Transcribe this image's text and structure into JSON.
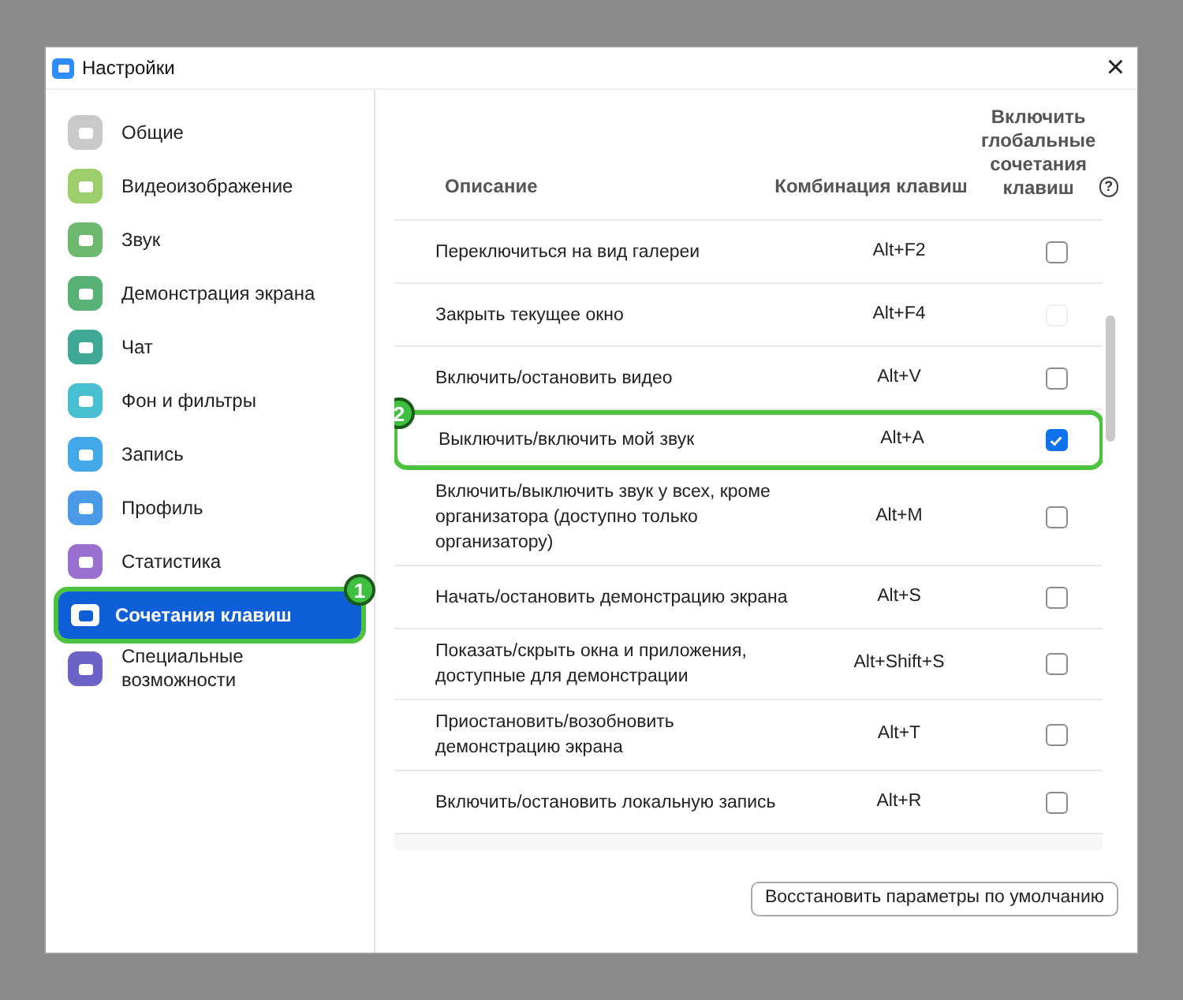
{
  "window": {
    "title": "Настройки",
    "close": "×"
  },
  "sidebar": {
    "items": [
      {
        "label": "Общие",
        "color": "#c9c9c9",
        "selected": false
      },
      {
        "label": "Видеоизображение",
        "color": "#9ccf6b",
        "selected": false
      },
      {
        "label": "Звук",
        "color": "#6fb86f",
        "selected": false
      },
      {
        "label": "Демонстрация экрана",
        "color": "#58b276",
        "selected": false
      },
      {
        "label": "Чат",
        "color": "#3fa996",
        "selected": false
      },
      {
        "label": "Фон и фильтры",
        "color": "#48bfd0",
        "selected": false
      },
      {
        "label": "Запись",
        "color": "#42a8e8",
        "selected": false
      },
      {
        "label": "Профиль",
        "color": "#4a9ae8",
        "selected": false
      },
      {
        "label": "Статистика",
        "color": "#9b6fd0",
        "selected": false
      },
      {
        "label": "Сочетания клавиш",
        "color": "#0e5fd8",
        "selected": true,
        "badge": "1"
      },
      {
        "label": "Специальные возможности",
        "color": "#6c63c7",
        "selected": false
      }
    ]
  },
  "table": {
    "columns": [
      "Описание",
      "Комбинация клавиш",
      "Включить глобальные сочетания клавиш"
    ],
    "help": "?",
    "rows": [
      {
        "description": "Переключиться на вид галереи",
        "shortcut": "Alt+F2",
        "checked": false,
        "disabled": false
      },
      {
        "description": "Закрыть текущее окно",
        "shortcut": "Alt+F4",
        "checked": false,
        "disabled": true
      },
      {
        "description": "Включить/остановить видео",
        "shortcut": "Alt+V",
        "checked": false,
        "disabled": false
      },
      {
        "description": "Выключить/включить мой звук",
        "shortcut": "Alt+A",
        "checked": true,
        "disabled": false,
        "badge": "2"
      },
      {
        "description": "Включить/выключить звук у всех, кроме организатора (доступно только организатору)",
        "shortcut": "Alt+M",
        "checked": false,
        "disabled": false
      },
      {
        "description": "Начать/остановить демонстрацию экрана",
        "shortcut": "Alt+S",
        "checked": false,
        "disabled": false
      },
      {
        "description": "Показать/скрыть окна и приложения, доступные для демонстрации",
        "shortcut": "Alt+Shift+S",
        "checked": false,
        "disabled": false
      },
      {
        "description": "Приостановить/возобновить демонстрацию экрана",
        "shortcut": "Alt+T",
        "checked": false,
        "disabled": false
      },
      {
        "description": "Включить/остановить локальную запись",
        "shortcut": "Alt+R",
        "checked": false,
        "disabled": false
      }
    ]
  },
  "restore_button": "Восстановить параметры по умолчанию"
}
